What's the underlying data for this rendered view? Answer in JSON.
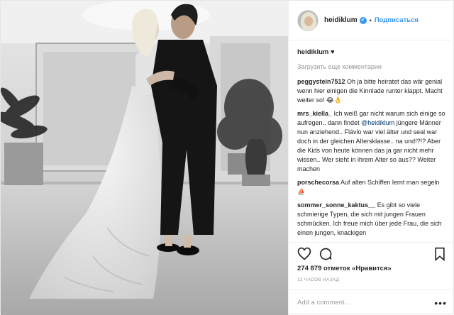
{
  "post": {
    "username": "heidiklum",
    "verified_badge": "✔",
    "separator": "•",
    "follow_label": "Подписаться",
    "caption_user": "heidiklum",
    "caption_text": "♥",
    "load_more": "Загрузить еще комментарии",
    "comments": [
      {
        "user": "peggystein7512",
        "text": " Oh ja bitte heiratet das wär genial wenn hier einigen die Kinnlade runter klappt. Macht weiter so! 😂👌"
      },
      {
        "user": "mrs_kiella_",
        "text_before": " Ich weiß gar nicht warum sich einige so aufregen.. dann findet ",
        "mention": "@heidiklum",
        "text_after": " jüngere Männer nun anziehend.. Flávio war viel älter und seal war doch in der gleichen Altersklasse.. na und!?!? Aber die Kids von heute können das ja gar nicht mehr wissen.. Wer sieht in ihrem Alter so aus?? Weiter machen"
      },
      {
        "user": "porschecorsa",
        "text": " Auf alten Schiffen lernt man segeln ⛵"
      },
      {
        "user": "sommer_sonne_kaktus__",
        "text": " Es gibt so viele schmierige Typen, die sich mit jungen Frauen schmücken. Ich freue mich über jede Frau, die sich einen jungen, knackigen"
      }
    ],
    "likes": "274 879 отметок «Нравится»",
    "timestamp": "13 ЧАСОВ НАЗАД",
    "add_comment_placeholder": "Add a comment...",
    "more_label": "•••",
    "icons": [
      "heart-icon",
      "comment-icon",
      "bookmark-icon",
      "more-options-icon"
    ]
  }
}
